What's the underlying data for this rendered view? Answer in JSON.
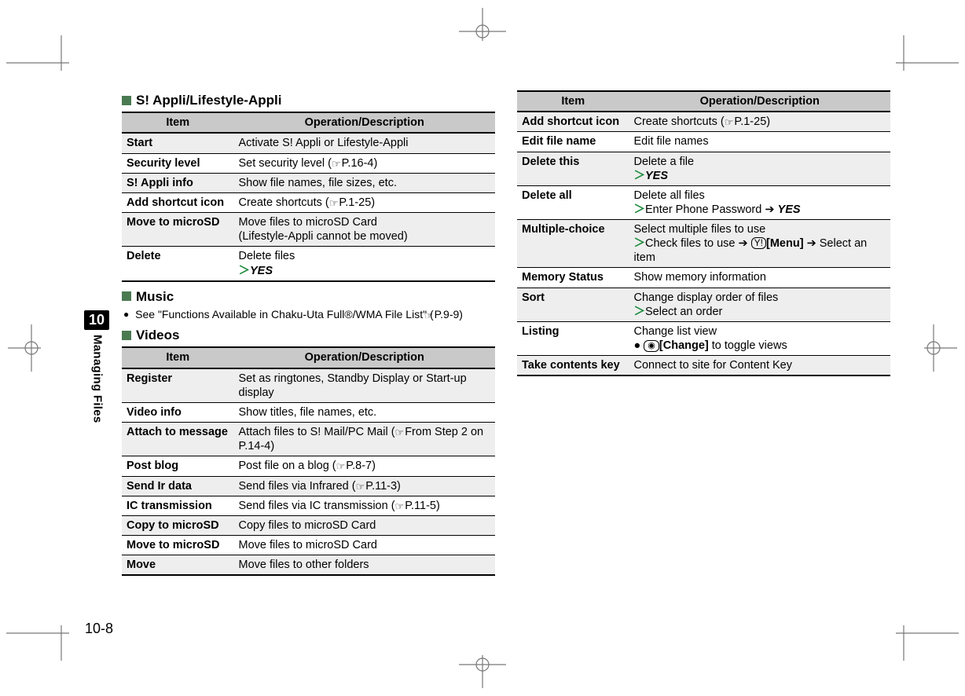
{
  "side_tab": {
    "chapter_number": "10",
    "chapter_title": "Managing Files"
  },
  "page_number": "10-8",
  "left": {
    "section1": {
      "title": "S! Appli/Lifestyle-Appli",
      "head_item": "Item",
      "head_op": "Operation/Description",
      "rows": [
        {
          "item": "Start",
          "op": "Activate S! Appli or Lifestyle-Appli"
        },
        {
          "item": "Security level",
          "op_pre": "Set security level (",
          "ref": "P.16-4",
          "op_post": ")"
        },
        {
          "item": "S! Appli info",
          "op": "Show file names, file sizes, etc."
        },
        {
          "item": "Add shortcut icon",
          "op_pre": "Create shortcuts (",
          "ref": "P.1-25",
          "op_post": ")"
        },
        {
          "item": "Move to microSD",
          "op_l1": "Move files to microSD Card",
          "op_l2": "(Lifestyle-Appli cannot be moved)"
        },
        {
          "item": "Delete",
          "op_l1": "Delete files",
          "yes": "YES"
        }
      ]
    },
    "section2": {
      "title": "Music",
      "note_pre": "See \"Functions Available in Chaku-Uta Full®/WMA File List\" (",
      "note_ref": "P.9-9",
      "note_post": ")"
    },
    "section3": {
      "title": "Videos",
      "head_item": "Item",
      "head_op": "Operation/Description",
      "rows": [
        {
          "item": "Register",
          "op": "Set as ringtones, Standby Display or Start-up display"
        },
        {
          "item": "Video info",
          "op": "Show titles, file names, etc."
        },
        {
          "item": "Attach to message",
          "op_pre": "Attach files to S! Mail/PC Mail (",
          "ref": "From Step 2 on P.14-4",
          "op_post": ")"
        },
        {
          "item": "Post blog",
          "op_pre": "Post file on a blog (",
          "ref": "P.8-7",
          "op_post": ")"
        },
        {
          "item": "Send Ir data",
          "op_pre": "Send files via Infrared (",
          "ref": "P.11-3",
          "op_post": ")"
        },
        {
          "item": "IC transmission",
          "op_pre": "Send files via IC transmission (",
          "ref": "P.11-5",
          "op_post": ")"
        },
        {
          "item": "Copy to microSD",
          "op": "Copy files to microSD Card"
        },
        {
          "item": "Move to microSD",
          "op": "Move files to microSD Card"
        },
        {
          "item": "Move",
          "op": "Move files to other folders"
        }
      ]
    }
  },
  "right": {
    "head_item": "Item",
    "head_op": "Operation/Description",
    "rows": {
      "addshortcut": {
        "item": "Add shortcut icon",
        "op_pre": "Create shortcuts (",
        "ref": "P.1-25",
        "op_post": ")"
      },
      "editfile": {
        "item": "Edit file name",
        "op": "Edit file names"
      },
      "deletethis": {
        "item": "Delete this",
        "op_l1": "Delete a file",
        "yes": "YES"
      },
      "deleteall": {
        "item": "Delete all",
        "op_l1": "Delete all files",
        "step": "Enter Phone Password",
        "yes": "YES"
      },
      "multiple": {
        "item": "Multiple-choice",
        "op_l1": "Select multiple files to use",
        "step": "Check files to use",
        "menu": "[Menu]",
        "tail": "Select an item"
      },
      "memory": {
        "item": "Memory Status",
        "op": "Show memory information"
      },
      "sort": {
        "item": "Sort",
        "op_l1": "Change display order of files",
        "step": "Select an order"
      },
      "listing": {
        "item": "Listing",
        "op_l1": "Change list view",
        "change": "[Change]",
        "tail": " to toggle views"
      },
      "take": {
        "item": "Take contents key",
        "op": "Connect to site for Content Key"
      }
    }
  }
}
